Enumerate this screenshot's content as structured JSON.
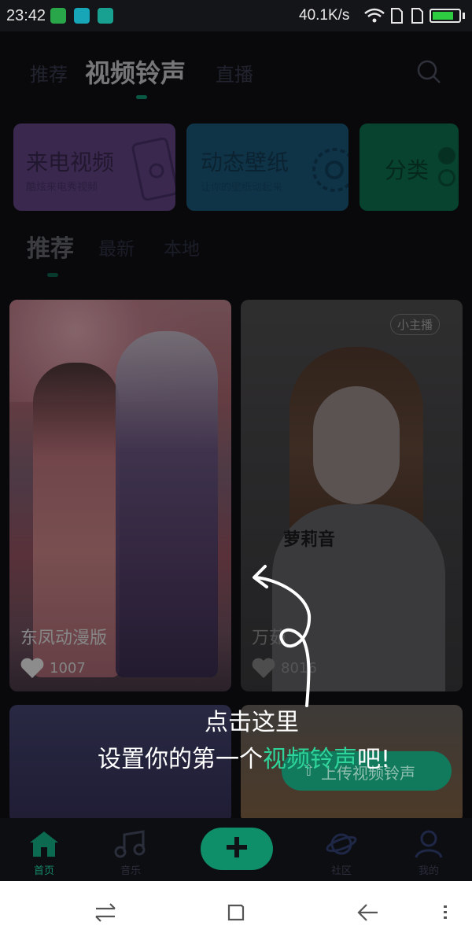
{
  "status_bar": {
    "time": "23:42",
    "network_speed": "40.1K/s",
    "battery_level": 0.8
  },
  "top_tabs": [
    {
      "label": "推荐",
      "active": false
    },
    {
      "label": "视频铃声",
      "active": true
    },
    {
      "label": "直播",
      "active": false
    }
  ],
  "feature_cards": [
    {
      "title": "来电视频",
      "subtitle": "酷炫来电秀视频",
      "color": "#6a4a8f"
    },
    {
      "title": "动态壁纸",
      "subtitle": "让你的壁纸动起来",
      "color": "#1d5f83"
    },
    {
      "title": "分类",
      "color": "#0e7a55"
    }
  ],
  "sub_tabs": [
    {
      "label": "推荐",
      "active": true
    },
    {
      "label": "最新",
      "active": false
    },
    {
      "label": "本地",
      "active": false
    }
  ],
  "videos": [
    {
      "title": "东凤动漫版",
      "likes": "1007"
    },
    {
      "title": "万茹",
      "likes": "8016",
      "badge": "小主播",
      "caption": "萝莉音"
    }
  ],
  "upload_button": {
    "label": "上传视频铃声"
  },
  "guide": {
    "line1": "点击这里",
    "line2_prefix": "设置你的第一个",
    "line2_highlight": "视频铃声",
    "line2_suffix": "吧!"
  },
  "bottom_nav": [
    {
      "label": "首页",
      "icon": "home-icon",
      "active": true
    },
    {
      "label": "音乐",
      "icon": "music-note-icon",
      "active": false
    },
    {
      "label": "社区",
      "icon": "planet-icon",
      "active": false
    },
    {
      "label": "我的",
      "icon": "person-icon",
      "active": false
    }
  ],
  "colors": {
    "accent": "#0e8e69",
    "background": "#111216",
    "highlight_text": "#2fd49a"
  }
}
